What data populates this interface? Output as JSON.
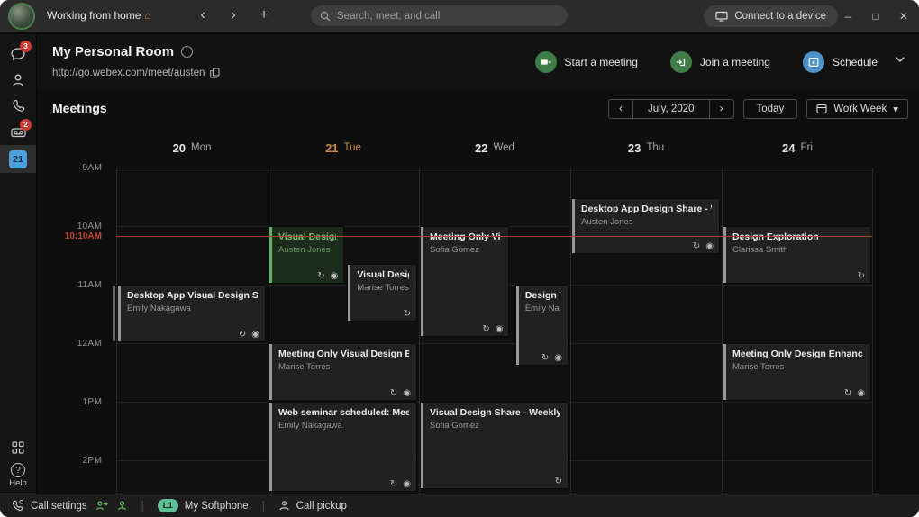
{
  "topbar": {
    "status_text": "Working from home",
    "status_emoji": "⌂",
    "nav": {
      "back": "‹",
      "forward": "›",
      "new": "+"
    },
    "search_placeholder": "Search, meet, and call",
    "connect_button": "Connect to a device",
    "window_controls": {
      "minimize": "–",
      "maximize": "□",
      "close": "✕"
    }
  },
  "sidebar": {
    "items": [
      {
        "name": "messaging",
        "badge": "3"
      },
      {
        "name": "contacts"
      },
      {
        "name": "calls"
      },
      {
        "name": "voicemail",
        "badge": "2"
      },
      {
        "name": "meetings",
        "date": "21",
        "selected": true
      }
    ],
    "help_label": "Help"
  },
  "personal_room": {
    "title": "My Personal Room",
    "url": "http://go.webex.com/meet/austen",
    "actions": [
      {
        "id": "start-meeting",
        "label": "Start a meeting",
        "color": "#3e7d48"
      },
      {
        "id": "join-meeting",
        "label": "Join a meeting",
        "color": "#3e7d48"
      },
      {
        "id": "schedule",
        "label": "Schedule",
        "color": "#4d93c9"
      }
    ]
  },
  "toolbar": {
    "title": "Meetings",
    "prev": "‹",
    "next": "›",
    "month_label": "July, 2020",
    "today_label": "Today",
    "view_label": "Work Week",
    "view_caret": "▾"
  },
  "calendar": {
    "days": [
      {
        "num": "20",
        "name": "Mon"
      },
      {
        "num": "21",
        "name": "Tue",
        "active": true
      },
      {
        "num": "22",
        "name": "Wed"
      },
      {
        "num": "23",
        "name": "Thu"
      },
      {
        "num": "24",
        "name": "Fri"
      }
    ],
    "times": [
      "9AM",
      "10AM",
      "11AM",
      "12AM",
      "1PM",
      "2PM"
    ],
    "current_time": {
      "label": "10:10AM",
      "hour": 10.17
    },
    "colors": {
      "active_day": "#cf8a3c",
      "now_line": "#a84232",
      "event_accent_green": "#58b85e"
    },
    "events": [
      {
        "title": "Desktop App Visual Design Sync",
        "organizer": "Emily Nakagawa",
        "day": 0,
        "start": 11,
        "end": 12,
        "icons": [
          "recurrence",
          "webex"
        ]
      },
      {
        "title": "Visual Design Enh",
        "organizer": "Austen Jones",
        "day": 1,
        "start": 10,
        "end": 11,
        "width_pct": 52,
        "variant": "green",
        "icons": [
          "recurrence",
          "webex"
        ]
      },
      {
        "title": "Visual Design Sha",
        "organizer": "Marise Torres",
        "day": 1,
        "start": 10.65,
        "end": 11.65,
        "left_pct": 52,
        "width_pct": 48,
        "icons": [
          "recurrence"
        ]
      },
      {
        "title": "Meeting Only Visual Design Explorat",
        "organizer": "Marise Torres",
        "day": 1,
        "start": 12,
        "end": 13,
        "icons": [
          "recurrence",
          "webex"
        ]
      },
      {
        "title": "Web seminar scheduled: Meeting",
        "organizer": "Emily Nakagawa",
        "day": 1,
        "start": 13,
        "end": 14.55,
        "icons": [
          "recurrence",
          "webex"
        ]
      },
      {
        "title": "Meeting Only Visual E",
        "organizer": "Sofia Gomez",
        "day": 2,
        "start": 10,
        "end": 11.9,
        "width_pct": 61,
        "icons": [
          "recurrence",
          "webex"
        ]
      },
      {
        "title": "Design Thing",
        "organizer": "Emily Nakagawa",
        "day": 2,
        "start": 11,
        "end": 12.4,
        "left_pct": 63,
        "width_pct": 37,
        "icons": [
          "recurrence",
          "webex"
        ]
      },
      {
        "title": "Visual Design Share - Weekly",
        "organizer": "Sofia Gomez",
        "day": 2,
        "start": 13,
        "end": 14.5,
        "icons": [
          "recurrence"
        ]
      },
      {
        "title": "Desktop App Design Share - Weekly",
        "organizer": "Austen Jones",
        "day": 3,
        "start": 9.53,
        "end": 10.5,
        "icons": [
          "recurrence",
          "webex"
        ]
      },
      {
        "title": "Design Exploration",
        "organizer": "Clarissa Smith",
        "day": 4,
        "start": 10,
        "end": 11,
        "icons": [
          "recurrence"
        ]
      },
      {
        "title": "Meeting Only Design Enhancement",
        "organizer": "Marise Torres",
        "day": 4,
        "start": 12,
        "end": 13,
        "icons": [
          "recurrence",
          "webex"
        ]
      }
    ]
  },
  "bottombar": {
    "call_settings": "Call settings",
    "softphone_badge": "L1",
    "softphone_label": "My Softphone",
    "call_pickup": "Call pickup"
  }
}
